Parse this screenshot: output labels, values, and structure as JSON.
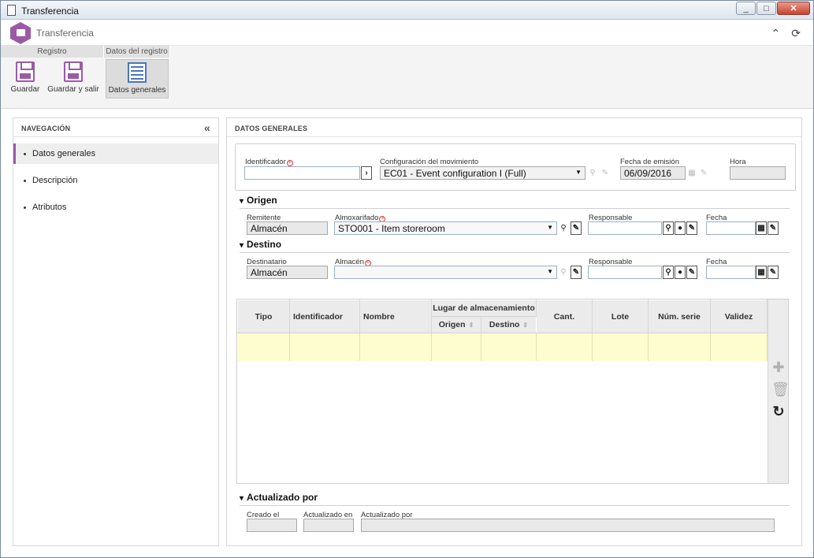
{
  "window": {
    "title": "Transferencia",
    "buttons": [
      "_",
      "□",
      "✕"
    ]
  },
  "app": {
    "title": "Transferencia"
  },
  "ribbon": {
    "groups": [
      {
        "label": "Registro"
      },
      {
        "label": "Datos del registro"
      }
    ],
    "save": "Guardar",
    "save_exit": "Guardar y salir",
    "general_data": "Datos generales"
  },
  "nav": {
    "header": "NAVEGACIÓN",
    "items": [
      {
        "label": "Datos generales"
      },
      {
        "label": "Descripción"
      },
      {
        "label": "Atributos"
      }
    ]
  },
  "main": {
    "header": "DATOS GENERALES",
    "top": {
      "identificador_label": "Identificador",
      "identificador_value": "",
      "config_label": "Configuración del movimiento",
      "config_value": "EC01 - Event configuration I (Full)",
      "fecha_emision_label": "Fecha de emisión",
      "fecha_emision_value": "06/09/2016",
      "hora_label": "Hora",
      "hora_value": ""
    },
    "origen": {
      "title": "Origen",
      "remitente_label": "Remitente",
      "remitente_value": "Almacén",
      "almox_label": "Almoxarifado",
      "almox_value": "STO001 - Item storeroom",
      "responsable_label": "Responsable",
      "responsable_value": "",
      "fecha_label": "Fecha",
      "fecha_value": ""
    },
    "destino": {
      "title": "Destino",
      "destinatario_label": "Destinatario",
      "destinatario_value": "Almacén",
      "almacen_label": "Almacén",
      "almacen_value": "",
      "responsable_label": "Responsable",
      "responsable_value": "",
      "fecha_label": "Fecha",
      "fecha_value": ""
    },
    "grid": {
      "columns": [
        "Tipo",
        "Identificador",
        "Nombre",
        "Lugar de almacenamiento",
        "Cant.",
        "Lote",
        "Núm. serie",
        "Validez"
      ],
      "subcolumns": [
        "Origen",
        "Destino"
      ]
    },
    "updated": {
      "title": "Actualizado por",
      "creado_label": "Creado el",
      "actualizado_en_label": "Actualizado en",
      "actualizado_por_label": "Actualizado por"
    }
  }
}
